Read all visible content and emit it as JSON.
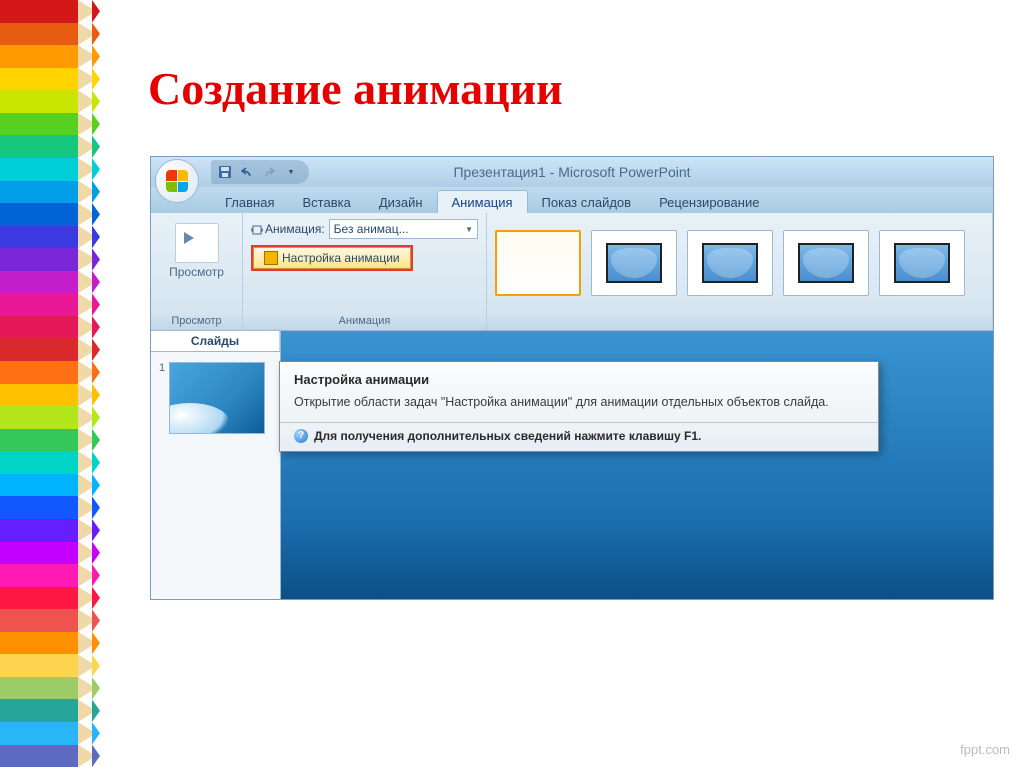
{
  "slide_title": "Создание анимации",
  "watermark": "fppt.com",
  "window_title": "Презентация1 - Microsoft PowerPoint",
  "tabs": [
    "Главная",
    "Вставка",
    "Дизайн",
    "Анимация",
    "Показ слайдов",
    "Рецензирование"
  ],
  "active_tab_index": 3,
  "ribbon": {
    "preview_group": {
      "button": "Просмотр",
      "label": "Просмотр"
    },
    "anim_group": {
      "label_prefix": "Анимация:",
      "dropdown_value": "Без анимац...",
      "custom_button": "Настройка анимации",
      "label": "Анимация"
    }
  },
  "slides_pane": {
    "tab": "Слайды",
    "thumb_number": "1"
  },
  "tooltip": {
    "title": "Настройка анимации",
    "body": "Открытие области задач \"Настройка анимации\" для анимации отдельных объектов слайда.",
    "help": "Для получения дополнительных сведений нажмите клавишу F1."
  },
  "pencil_colors": [
    "#d41818",
    "#e85c12",
    "#ff9a00",
    "#ffd400",
    "#c9e600",
    "#58d020",
    "#16c77e",
    "#00cfd9",
    "#009fe8",
    "#0064d6",
    "#3b39e0",
    "#7a26d9",
    "#c31ec9",
    "#e81896",
    "#e6185c",
    "#d82a2a",
    "#ff7014",
    "#ffc000",
    "#b3e61b",
    "#34c759",
    "#00d4c7",
    "#00b4ff",
    "#1159ff",
    "#651fff",
    "#c400ff",
    "#ff1ab3",
    "#ff1744",
    "#ef5350",
    "#ff9100",
    "#ffd54f",
    "#9ccc65",
    "#26a69a",
    "#29b6f6",
    "#5c6bc0"
  ]
}
